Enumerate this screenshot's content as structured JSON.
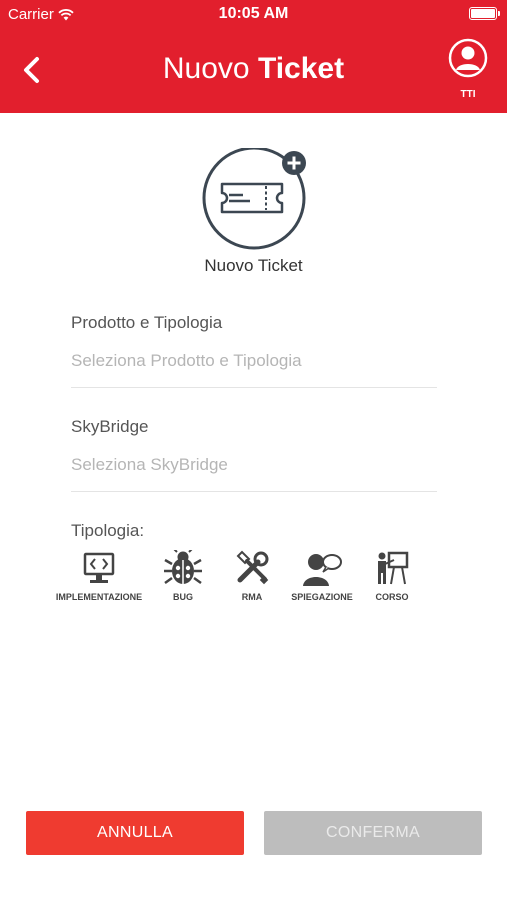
{
  "status_bar": {
    "carrier": "Carrier",
    "time": "10:05 AM"
  },
  "header": {
    "title_light": "Nuovo",
    "title_bold": "Ticket",
    "user_label": "TTI",
    "color": "#e21f2d"
  },
  "ticket": {
    "caption": "Nuovo Ticket"
  },
  "form": {
    "prodotto": {
      "label": "Prodotto e Tipologia",
      "placeholder": "Seleziona Prodotto e Tipologia"
    },
    "skybridge": {
      "label": "SkyBridge",
      "placeholder": "Seleziona SkyBridge"
    },
    "tipologia_label": "Tipologia:",
    "types": [
      {
        "label": "IMPLEMENTAZIONE",
        "icon": "monitor-code-icon"
      },
      {
        "label": "BUG",
        "icon": "bug-icon"
      },
      {
        "label": "RMA",
        "icon": "tools-icon"
      },
      {
        "label": "SPIEGAZIONE",
        "icon": "person-speech-icon"
      },
      {
        "label": "CORSO",
        "icon": "presentation-icon"
      }
    ]
  },
  "actions": {
    "cancel": "ANNULLA",
    "confirm": "CONFERMA"
  }
}
